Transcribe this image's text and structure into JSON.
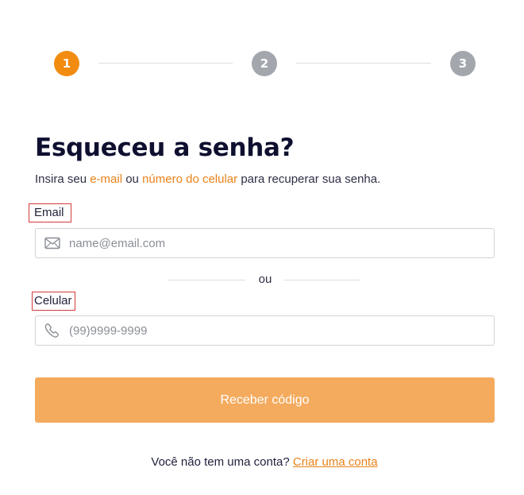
{
  "stepper": {
    "steps": [
      {
        "label": "1",
        "state": "active"
      },
      {
        "label": "2",
        "state": "inactive"
      },
      {
        "label": "3",
        "state": "inactive"
      }
    ],
    "active_color": "#f28c10",
    "inactive_color": "#a3a7ad"
  },
  "header": {
    "title": "Esqueceu a senha?",
    "subtitle_prefix": "Insira seu ",
    "subtitle_email": "e-mail",
    "subtitle_or": " ou ",
    "subtitle_phone": "número do celular",
    "subtitle_suffix": " para recuperar sua senha."
  },
  "form": {
    "email_label": "Email",
    "email_placeholder": "name@email.com",
    "email_icon": "envelope-icon",
    "divider_text": "ou",
    "phone_label": "Celular",
    "phone_placeholder": "(99)9999-9999",
    "phone_icon": "phone-icon",
    "submit_label": "Receber código"
  },
  "footer": {
    "question": "Você não tem uma conta?",
    "link_label": "Criar uma conta"
  },
  "colors": {
    "accent": "#e8821a",
    "button": "#f4ab5e",
    "title": "#0f1030"
  }
}
